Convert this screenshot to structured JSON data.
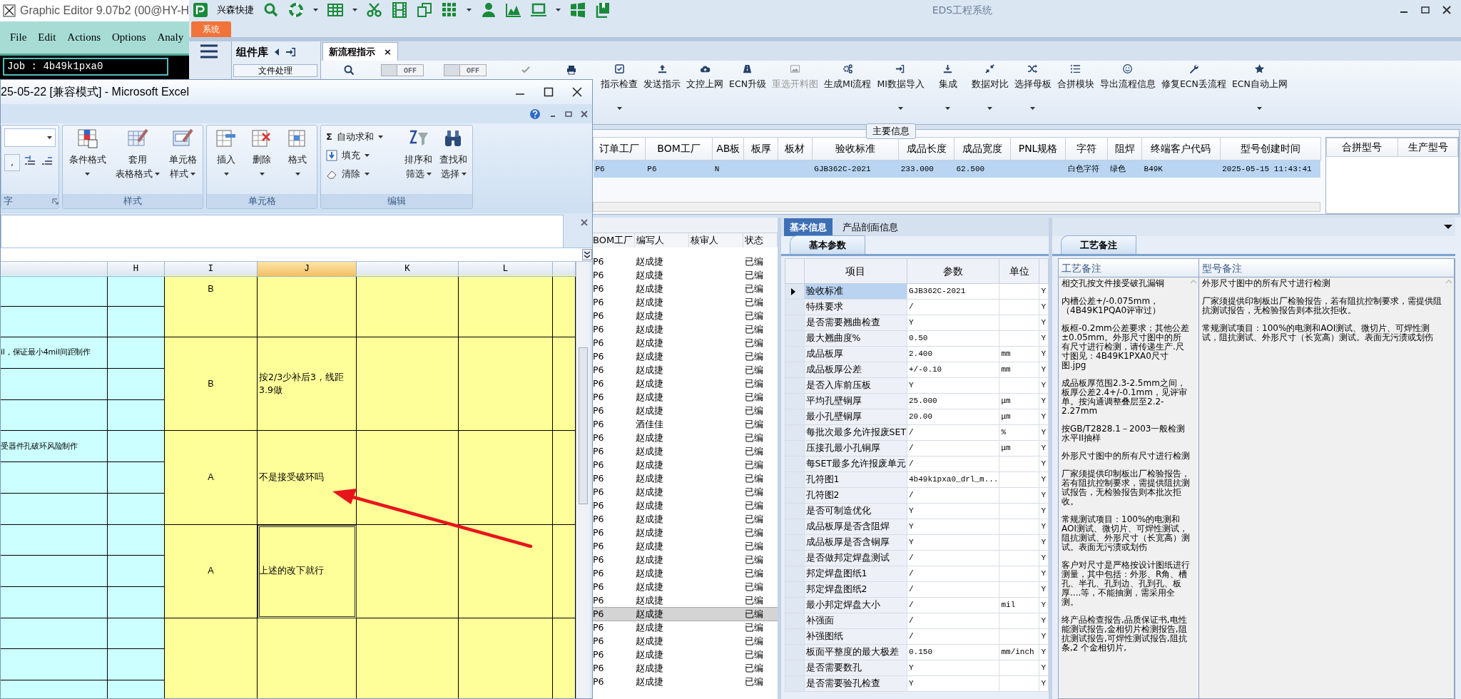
{
  "graphic_editor": {
    "title": "Graphic Editor 9.07b2 (00@HY-H",
    "menu": [
      "File",
      "Edit",
      "Actions",
      "Options",
      "Analy"
    ],
    "job": "Job : 4b49k1pxa0"
  },
  "eds": {
    "quick_label": "兴森快捷",
    "title": "EDS工程系统",
    "system_tab": "系统",
    "panel_title": "组件库",
    "panel_button": "文件处理",
    "doc_tab": "新流程指示",
    "doc_tab_close": "×",
    "toggles": [
      {
        "label": "OFF",
        "on": false
      },
      {
        "label": "OFF",
        "on": false
      }
    ],
    "ribbon": [
      {
        "label": "指示检查",
        "dropdown": true,
        "disabled": false
      },
      {
        "label": "发送指示",
        "dropdown": false,
        "disabled": false
      },
      {
        "label": "文控上网",
        "dropdown": false,
        "disabled": false
      },
      {
        "label": "ECN升级",
        "dropdown": false,
        "disabled": false
      },
      {
        "label": "重选开料图",
        "dropdown": false,
        "disabled": true
      },
      {
        "label": "生成MI流程",
        "dropdown": false,
        "disabled": false
      },
      {
        "label": "MI数据导入",
        "dropdown": true,
        "disabled": false
      },
      {
        "label": "集成",
        "dropdown": true,
        "disabled": false
      },
      {
        "label": "数据对比",
        "dropdown": true,
        "disabled": false
      },
      {
        "label": "选择母板",
        "dropdown": true,
        "disabled": false
      },
      {
        "label": "合拼模块",
        "dropdown": false,
        "disabled": false
      },
      {
        "label": "导出流程信息",
        "dropdown": false,
        "disabled": false
      },
      {
        "label": "修复ECN丢流程",
        "dropdown": false,
        "disabled": false
      },
      {
        "label": "ECN自动上网",
        "dropdown": true,
        "disabled": false
      }
    ],
    "main_info": {
      "legend": "主要信息",
      "columns": [
        "订单工厂",
        "BOM工厂",
        "AB板",
        "板厚",
        "板材",
        "验收标准",
        "成品长度",
        "成品宽度",
        "PNL规格",
        "字符",
        "阻焊",
        "终端客户代码",
        "型号创建时间"
      ],
      "rows": [
        {
          "cells": [
            "P6",
            "P6",
            "N",
            "",
            "",
            "GJB362C-2021",
            "233.000",
            "62.500",
            "",
            "白色字符",
            "绿色",
            "B49K",
            "2025-05-15 11:43:41"
          ],
          "selected": true
        }
      ],
      "side_columns": [
        "合拼型号",
        "生产型号"
      ]
    },
    "list": {
      "columns": [
        "BOM工厂",
        "编写人",
        "核审人",
        "状态"
      ],
      "rows": [
        {
          "bom": "P6",
          "writer": "赵成捷",
          "status": "已编",
          "selected": false
        },
        {
          "bom": "P6",
          "writer": "赵成捷",
          "status": "已编",
          "selected": false
        },
        {
          "bom": "P6",
          "writer": "赵成捷",
          "status": "已编",
          "selected": false
        },
        {
          "bom": "P6",
          "writer": "赵成捷",
          "status": "已编",
          "selected": false
        },
        {
          "bom": "P6",
          "writer": "赵成捷",
          "status": "已编",
          "selected": false
        },
        {
          "bom": "P6",
          "writer": "赵成捷",
          "status": "已编",
          "selected": false
        },
        {
          "bom": "P6",
          "writer": "赵成捷",
          "status": "已编",
          "selected": false
        },
        {
          "bom": "P6",
          "writer": "赵成捷",
          "status": "已编",
          "selected": false
        },
        {
          "bom": "P6",
          "writer": "赵成捷",
          "status": "已编",
          "selected": false
        },
        {
          "bom": "P6",
          "writer": "赵成捷",
          "status": "已编",
          "selected": false
        },
        {
          "bom": "P6",
          "writer": "赵成捷",
          "status": "已编",
          "selected": false
        },
        {
          "bom": "P6",
          "writer": "赵成捷",
          "status": "已编",
          "selected": false
        },
        {
          "bom": "P6",
          "writer": "酒佳佳",
          "status": "已编",
          "selected": false
        },
        {
          "bom": "P6",
          "writer": "赵成捷",
          "status": "已编",
          "selected": false
        },
        {
          "bom": "P6",
          "writer": "赵成捷",
          "status": "已编",
          "selected": false
        },
        {
          "bom": "P6",
          "writer": "赵成捷",
          "status": "已编",
          "selected": false
        },
        {
          "bom": "P6",
          "writer": "赵成捷",
          "status": "已编",
          "selected": false
        },
        {
          "bom": "P6",
          "writer": "赵成捷",
          "status": "已编",
          "selected": false
        },
        {
          "bom": "P6",
          "writer": "赵成捷",
          "status": "已编",
          "selected": false
        },
        {
          "bom": "P6",
          "writer": "赵成捷",
          "status": "已编",
          "selected": false
        },
        {
          "bom": "P6",
          "writer": "赵成捷",
          "status": "已编",
          "selected": false
        },
        {
          "bom": "P6",
          "writer": "赵成捷",
          "status": "已编",
          "selected": false
        },
        {
          "bom": "P6",
          "writer": "赵成捷",
          "status": "已编",
          "selected": false
        },
        {
          "bom": "P6",
          "writer": "赵成捷",
          "status": "已编",
          "selected": false
        },
        {
          "bom": "P6",
          "writer": "赵成捷",
          "status": "已编",
          "selected": false
        },
        {
          "bom": "P6",
          "writer": "赵成捷",
          "status": "已编",
          "selected": false
        },
        {
          "bom": "P6",
          "writer": "赵成捷",
          "status": "已编",
          "selected": true
        },
        {
          "bom": "P6",
          "writer": "赵成捷",
          "status": "已编",
          "selected": false
        },
        {
          "bom": "P6",
          "writer": "赵成捷",
          "status": "已编",
          "selected": false
        },
        {
          "bom": "P6",
          "writer": "赵成捷",
          "status": "已编",
          "selected": false
        },
        {
          "bom": "P6",
          "writer": "赵成捷",
          "status": "已编",
          "selected": false
        },
        {
          "bom": "P6",
          "writer": "赵成捷",
          "status": "已编",
          "selected": false
        }
      ]
    },
    "params": {
      "tabs": [
        {
          "label": "基本信息",
          "selected": true
        },
        {
          "label": "产品剖面信息",
          "selected": false
        }
      ],
      "subtab": "基本参数",
      "columns": [
        "项目",
        "参数",
        "单位"
      ],
      "rows": [
        {
          "item": "验收标准",
          "value": "GJB362C-2021",
          "unit": "",
          "column_5": "Y",
          "selected": true
        },
        {
          "item": "特殊要求",
          "value": "/",
          "unit": "",
          "column_5": "Y",
          "selected": false
        },
        {
          "item": "是否需要翘曲检查",
          "value": "Y",
          "unit": "",
          "column_5": "Y",
          "selected": false
        },
        {
          "item": "最大翘曲度%",
          "value": "0.50",
          "unit": "",
          "column_5": "Y",
          "selected": false
        },
        {
          "item": "成品板厚",
          "value": "2.400",
          "unit": "mm",
          "column_5": "Y",
          "selected": false
        },
        {
          "item": "成品板厚公差",
          "value": "+/-0.10",
          "unit": "mm",
          "column_5": "Y",
          "selected": false
        },
        {
          "item": "是否入库前压板",
          "value": "Y",
          "unit": "",
          "column_5": "Y",
          "selected": false
        },
        {
          "item": "平均孔壁铜厚",
          "value": "25.000",
          "unit": "μm",
          "column_5": "Y",
          "selected": false
        },
        {
          "item": "最小孔壁铜厚",
          "value": "20.00",
          "unit": "μm",
          "column_5": "Y",
          "selected": false
        },
        {
          "item": "每批次最多允许报废SET",
          "value": "/",
          "unit": "%",
          "column_5": "Y",
          "selected": false
        },
        {
          "item": "压接孔最小孔铜厚",
          "value": "/",
          "unit": "μm",
          "column_5": "Y",
          "selected": false
        },
        {
          "item": "每SET最多允许报废单元",
          "value": "/",
          "unit": "",
          "column_5": "Y",
          "selected": false
        },
        {
          "item": "孔符图1",
          "value": "4b49k1pxa0_drl_m...",
          "unit": "",
          "column_5": "Y",
          "selected": false
        },
        {
          "item": "孔符图2",
          "value": "/",
          "unit": "",
          "column_5": "Y",
          "selected": false
        },
        {
          "item": "是否可制造优化",
          "value": "Y",
          "unit": "",
          "column_5": "Y",
          "selected": false
        },
        {
          "item": "成品板厚是否含阻焊",
          "value": "Y",
          "unit": "",
          "column_5": "Y",
          "selected": false
        },
        {
          "item": "成品板厚是否含铜厚",
          "value": "Y",
          "unit": "",
          "column_5": "Y",
          "selected": false
        },
        {
          "item": "是否做邦定焊盘测试",
          "value": "/",
          "unit": "",
          "column_5": "Y",
          "selected": false
        },
        {
          "item": "邦定焊盘图纸1",
          "value": "/",
          "unit": "",
          "column_5": "Y",
          "selected": false
        },
        {
          "item": "邦定焊盘图纸2",
          "value": "/",
          "unit": "",
          "column_5": "Y",
          "selected": false
        },
        {
          "item": "最小邦定焊盘大小",
          "value": "/",
          "unit": "mil",
          "column_5": "Y",
          "selected": false
        },
        {
          "item": "补强面",
          "value": "/",
          "unit": "",
          "column_5": "Y",
          "selected": false
        },
        {
          "item": "补强图纸",
          "value": "/",
          "unit": "",
          "column_5": "Y",
          "selected": false
        },
        {
          "item": "板面平整度的最大极差",
          "value": "0.150",
          "unit": "mm/inch",
          "column_5": "Y",
          "selected": false
        },
        {
          "item": "是否需要数孔",
          "value": "Y",
          "unit": "",
          "column_5": "Y",
          "selected": false
        },
        {
          "item": "是否需要验孔检查",
          "value": "Y",
          "unit": "",
          "column_5": "Y",
          "selected": false
        }
      ]
    },
    "notes": {
      "tab": "工艺备注",
      "columns": [
        "工艺备注",
        "型号备注"
      ],
      "process": [
        "相交孔按文件接受破孔漏铜",
        "内槽公差+/-0.075mm，（4B49K1PQA0评审过）",
        "板框-0.2mm公差要求；其他公差±0.05mm。外形尺寸图中的所有尺寸进行检测，请传递生产.尺寸图见：4B49K1PXA0尺寸图.jpg",
        "成品板厚范围2.3-2.5mm之间，板厚公差2.4+/-0.1mm，见评审单。按沟通调整叠层至2.2-2.27mm",
        "按GB/T2828.1－2003一般检测水平II抽样",
        "外形尺寸图中的所有尺寸进行检测",
        "厂家须提供印制板出厂检验报告，若有阻抗控制要求，需提供阻抗测试报告，无检验报告则本批次拒收。",
        "常规测试项目：100%的电测和AOI测试、微切片、可焊性测试，阻抗测试、外形尺寸（长宽高）测试。表面无污渍或划伤",
        "客户对尺寸是严格按设计图纸进行测量，其中包括：外形、R角、槽孔、半孔、孔到边、孔到孔、板厚....等，不能抽测，需采用全测。",
        "终产品检查报告,品质保证书,电性能测试报告,金相切片检测报告,阻抗测试报告,可焊性测试报告,阻抗条,2 个金相切片,"
      ],
      "model": [
        "外形尺寸图中的所有尺寸进行检测",
        "厂家须提供印制板出厂检验报告，若有阻抗控制要求，需提供阻抗测试报告，无检验报告则本批次拒收。",
        "常规测试项目：100%的电测和AOI测试、微切片、可焊性测试，阻抗测试、外形尺寸（长宽高）测试。表面无污渍或划伤"
      ]
    }
  },
  "excel": {
    "title": "25-05-22  [兼容模式] - Microsoft Excel",
    "number_group": {
      "label": "字",
      "comma": ","
    },
    "groups": [
      {
        "label": "样式",
        "items": [
          {
            "kind": "large",
            "lines": [
              "条件格式"
            ]
          },
          {
            "kind": "large",
            "lines": [
              "套用",
              "表格格式"
            ]
          },
          {
            "kind": "large",
            "lines": [
              "单元格",
              "样式"
            ]
          }
        ]
      },
      {
        "label": "单元格",
        "items": [
          {
            "kind": "large",
            "lines": [
              "插入"
            ]
          },
          {
            "kind": "large",
            "lines": [
              "删除"
            ]
          },
          {
            "kind": "large",
            "lines": [
              "格式"
            ]
          }
        ]
      },
      {
        "label": "编辑",
        "items": [
          {
            "kind": "small",
            "icon": "Σ",
            "label": "自动求和"
          },
          {
            "kind": "small",
            "label": "填充"
          },
          {
            "kind": "small",
            "label": "清除"
          },
          {
            "kind": "large",
            "lines": [
              "排序和",
              "筛选"
            ]
          },
          {
            "kind": "large",
            "lines": [
              "查找和",
              "选择"
            ]
          }
        ]
      }
    ],
    "columns": [
      {
        "label": "H",
        "selected": false
      },
      {
        "label": "I",
        "selected": false
      },
      {
        "label": "J",
        "selected": true
      },
      {
        "label": "K",
        "selected": false
      },
      {
        "label": "L",
        "selected": false
      }
    ],
    "blocks": [
      {
        "grade": "B",
        "selected": false
      },
      {
        "grade": "B",
        "left_text": "il，保证最小4mil间距制作",
        "note": "按2/3少补后3，线距3.9做",
        "selected": false
      },
      {
        "grade": "A",
        "left_text": "受器件孔破环风险制作",
        "note": "不是接受破环吗",
        "selected": false
      },
      {
        "grade": "A",
        "note": "上述的改下就行",
        "selected": true
      },
      {
        "selected": false
      }
    ]
  }
}
